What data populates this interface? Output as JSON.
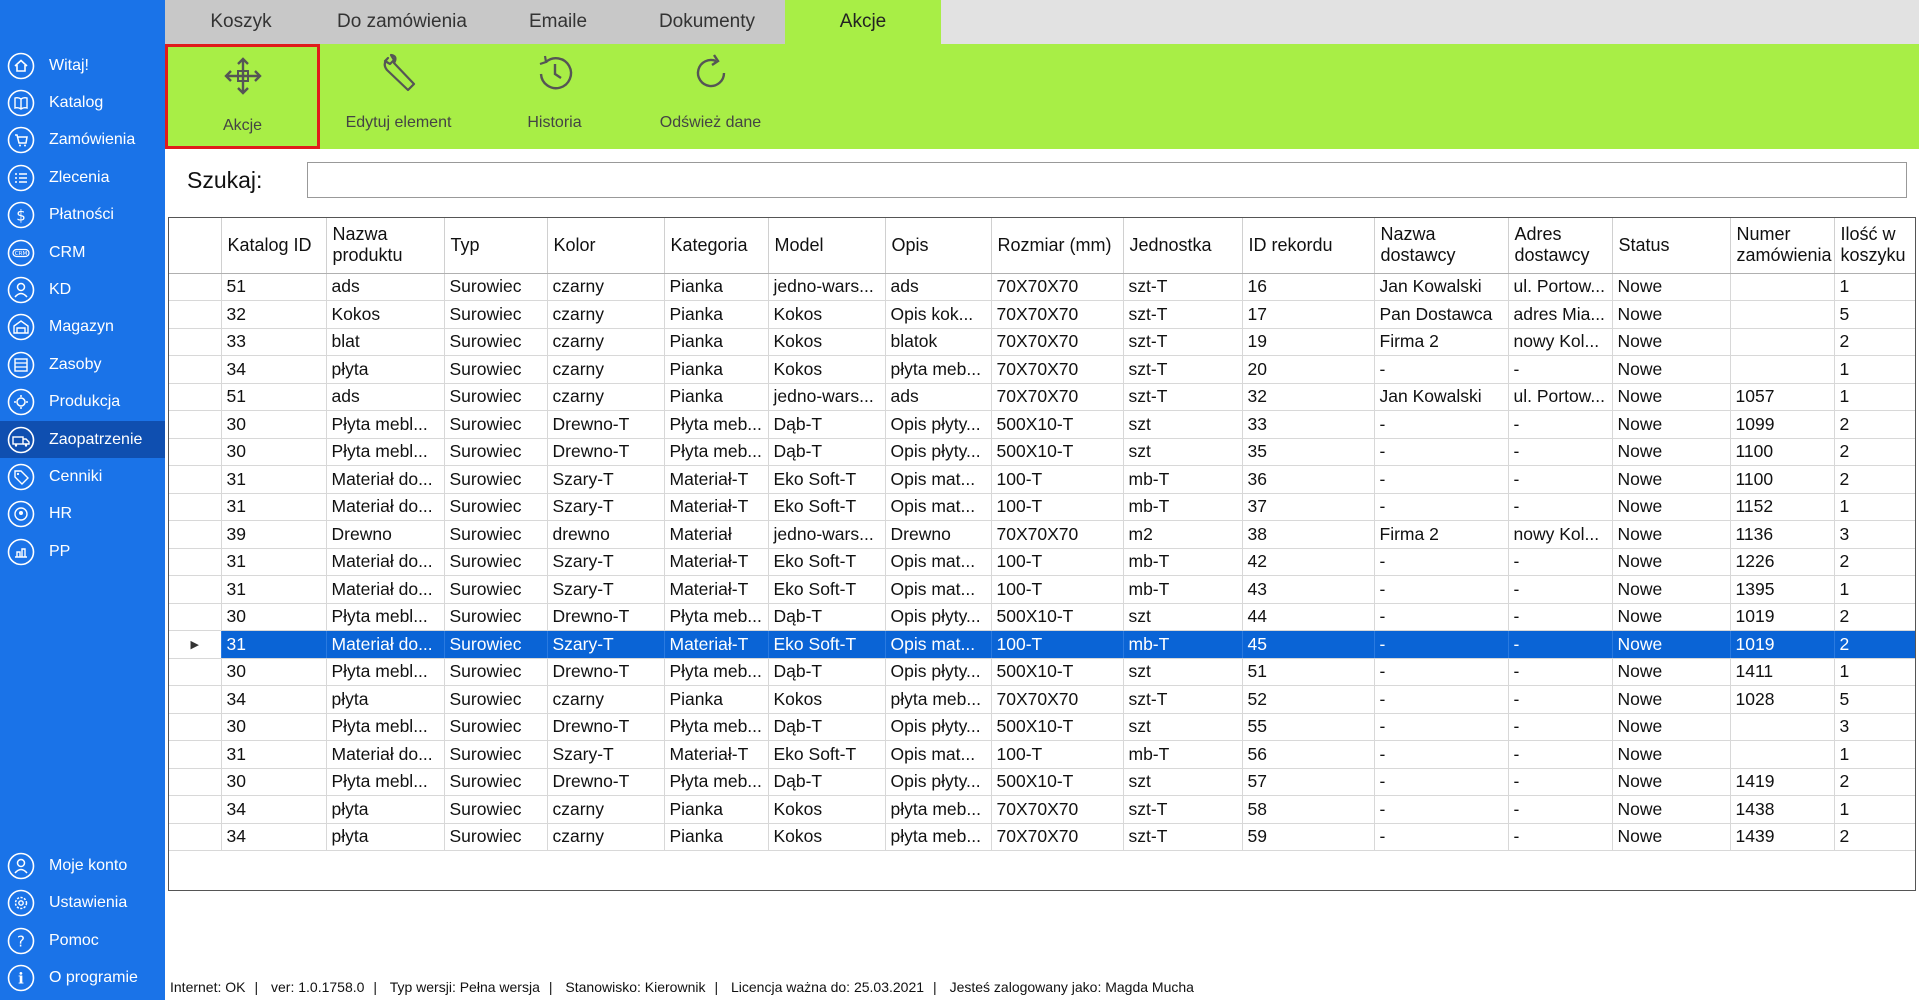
{
  "sidebar": {
    "items": [
      {
        "label": "Witaj!",
        "icon": "home-icon"
      },
      {
        "label": "Katalog",
        "icon": "book-icon"
      },
      {
        "label": "Zamówienia",
        "icon": "cart-icon"
      },
      {
        "label": "Zlecenia",
        "icon": "list-icon"
      },
      {
        "label": "Płatności",
        "icon": "dollar-icon"
      },
      {
        "label": "CRM",
        "icon": "crm-icon"
      },
      {
        "label": "KD",
        "icon": "user-icon"
      },
      {
        "label": "Magazyn",
        "icon": "warehouse-icon"
      },
      {
        "label": "Zasoby",
        "icon": "archive-icon"
      },
      {
        "label": "Produkcja",
        "icon": "production-icon"
      },
      {
        "label": "Zaopatrzenie",
        "icon": "supply-icon"
      },
      {
        "label": "Cenniki",
        "icon": "tag-icon"
      },
      {
        "label": "HR",
        "icon": "hr-icon"
      },
      {
        "label": "PP",
        "icon": "pp-icon"
      }
    ],
    "bottom_items": [
      {
        "label": "Moje konto",
        "icon": "account-icon"
      },
      {
        "label": "Ustawienia",
        "icon": "gear-icon"
      },
      {
        "label": "Pomoc",
        "icon": "help-icon"
      },
      {
        "label": "O programie",
        "icon": "info-icon"
      }
    ]
  },
  "tabs": [
    {
      "label": "Koszyk"
    },
    {
      "label": "Do zamówienia"
    },
    {
      "label": "Emaile"
    },
    {
      "label": "Dokumenty"
    },
    {
      "label": "Akcje"
    }
  ],
  "ribbon": {
    "buttons": [
      {
        "label": "Akcje",
        "icon": "move-arrows-icon"
      },
      {
        "label": "Edytuj element",
        "icon": "wrench-icon"
      },
      {
        "label": "Historia",
        "icon": "history-icon"
      },
      {
        "label": "Odśwież dane",
        "icon": "refresh-icon"
      }
    ]
  },
  "search": {
    "label": "Szukaj:",
    "value": ""
  },
  "table": {
    "columns": [
      "Katalog ID",
      "Nazwa produktu",
      "Typ",
      "Kolor",
      "Kategoria",
      "Model",
      "Opis",
      "Rozmiar (mm)",
      "Jednostka",
      "ID rekordu",
      "Nazwa dostawcy",
      "Adres dostawcy",
      "Status",
      "Numer zamówienia",
      "Ilość w koszyku"
    ],
    "rows": [
      [
        "51",
        "ads",
        "Surowiec",
        "czarny",
        "Pianka",
        "jedno-wars...",
        "ads",
        "70X70X70",
        "szt-T",
        "16",
        "Jan Kowalski",
        "ul. Portow...",
        "Nowe",
        "",
        "1"
      ],
      [
        "32",
        "Kokos",
        "Surowiec",
        "czarny",
        "Pianka",
        "Kokos",
        "Opis kok...",
        "70X70X70",
        "szt-T",
        "17",
        "Pan Dostawca",
        "adres Mia...",
        "Nowe",
        "",
        "5"
      ],
      [
        "33",
        "blat",
        "Surowiec",
        "czarny",
        "Pianka",
        "Kokos",
        "blatok",
        "70X70X70",
        "szt-T",
        "19",
        "Firma 2",
        "nowy Kol...",
        "Nowe",
        "",
        "2"
      ],
      [
        "34",
        "płyta",
        "Surowiec",
        "czarny",
        "Pianka",
        "Kokos",
        "płyta meb...",
        "70X70X70",
        "szt-T",
        "20",
        "-",
        "-",
        "Nowe",
        "",
        "1"
      ],
      [
        "51",
        "ads",
        "Surowiec",
        "czarny",
        "Pianka",
        "jedno-wars...",
        "ads",
        "70X70X70",
        "szt-T",
        "32",
        "Jan Kowalski",
        "ul. Portow...",
        "Nowe",
        "1057",
        "1"
      ],
      [
        "30",
        "Płyta mebl...",
        "Surowiec",
        "Drewno-T",
        "Płyta meb...",
        "Dąb-T",
        "Opis płyty...",
        "500X10-T",
        "szt",
        "33",
        "-",
        "-",
        "Nowe",
        "1099",
        "2"
      ],
      [
        "30",
        "Płyta mebl...",
        "Surowiec",
        "Drewno-T",
        "Płyta meb...",
        "Dąb-T",
        "Opis płyty...",
        "500X10-T",
        "szt",
        "35",
        "-",
        "-",
        "Nowe",
        "1100",
        "2"
      ],
      [
        "31",
        "Materiał do...",
        "Surowiec",
        "Szary-T",
        "Materiał-T",
        "Eko Soft-T",
        "Opis mat...",
        "100-T",
        "mb-T",
        "36",
        "-",
        "-",
        "Nowe",
        "1100",
        "2"
      ],
      [
        "31",
        "Materiał do...",
        "Surowiec",
        "Szary-T",
        "Materiał-T",
        "Eko Soft-T",
        "Opis mat...",
        "100-T",
        "mb-T",
        "37",
        "-",
        "-",
        "Nowe",
        "1152",
        "1"
      ],
      [
        "39",
        "Drewno",
        "Surowiec",
        "drewno",
        "Materiał",
        "jedno-wars...",
        "Drewno",
        "70X70X70",
        "m2",
        "38",
        "Firma 2",
        "nowy Kol...",
        "Nowe",
        "1136",
        "3"
      ],
      [
        "31",
        "Materiał do...",
        "Surowiec",
        "Szary-T",
        "Materiał-T",
        "Eko Soft-T",
        "Opis mat...",
        "100-T",
        "mb-T",
        "42",
        "-",
        "-",
        "Nowe",
        "1226",
        "2"
      ],
      [
        "31",
        "Materiał do...",
        "Surowiec",
        "Szary-T",
        "Materiał-T",
        "Eko Soft-T",
        "Opis mat...",
        "100-T",
        "mb-T",
        "43",
        "-",
        "-",
        "Nowe",
        "1395",
        "1"
      ],
      [
        "30",
        "Płyta mebl...",
        "Surowiec",
        "Drewno-T",
        "Płyta meb...",
        "Dąb-T",
        "Opis płyty...",
        "500X10-T",
        "szt",
        "44",
        "-",
        "-",
        "Nowe",
        "1019",
        "2"
      ],
      [
        "31",
        "Materiał do...",
        "Surowiec",
        "Szary-T",
        "Materiał-T",
        "Eko Soft-T",
        "Opis mat...",
        "100-T",
        "mb-T",
        "45",
        "-",
        "-",
        "Nowe",
        "1019",
        "2"
      ],
      [
        "30",
        "Płyta mebl...",
        "Surowiec",
        "Drewno-T",
        "Płyta meb...",
        "Dąb-T",
        "Opis płyty...",
        "500X10-T",
        "szt",
        "51",
        "-",
        "-",
        "Nowe",
        "1411",
        "1"
      ],
      [
        "34",
        "płyta",
        "Surowiec",
        "czarny",
        "Pianka",
        "Kokos",
        "płyta meb...",
        "70X70X70",
        "szt-T",
        "52",
        "-",
        "-",
        "Nowe",
        "1028",
        "5"
      ],
      [
        "30",
        "Płyta mebl...",
        "Surowiec",
        "Drewno-T",
        "Płyta meb...",
        "Dąb-T",
        "Opis płyty...",
        "500X10-T",
        "szt",
        "55",
        "-",
        "-",
        "Nowe",
        "",
        "3"
      ],
      [
        "31",
        "Materiał do...",
        "Surowiec",
        "Szary-T",
        "Materiał-T",
        "Eko Soft-T",
        "Opis mat...",
        "100-T",
        "mb-T",
        "56",
        "-",
        "-",
        "Nowe",
        "",
        "1"
      ],
      [
        "30",
        "Płyta mebl...",
        "Surowiec",
        "Drewno-T",
        "Płyta meb...",
        "Dąb-T",
        "Opis płyty...",
        "500X10-T",
        "szt",
        "57",
        "-",
        "-",
        "Nowe",
        "1419",
        "2"
      ],
      [
        "34",
        "płyta",
        "Surowiec",
        "czarny",
        "Pianka",
        "Kokos",
        "płyta meb...",
        "70X70X70",
        "szt-T",
        "58",
        "-",
        "-",
        "Nowe",
        "1438",
        "1"
      ],
      [
        "34",
        "płyta",
        "Surowiec",
        "czarny",
        "Pianka",
        "Kokos",
        "płyta meb...",
        "70X70X70",
        "szt-T",
        "59",
        "-",
        "-",
        "Nowe",
        "1439",
        "2"
      ]
    ]
  },
  "status": {
    "parts": [
      "Internet: OK",
      "ver: 1.0.1758.0",
      "Typ wersji: Pełna wersja",
      "Stanowisko: Kierownik",
      "Licencja ważna do: 25.03.2021",
      "Jesteś zalogowany jako: Magda Mucha"
    ]
  },
  "colors": {
    "sidebar_bg": "#1a73e8",
    "sidebar_active": "#0f4fb0",
    "ribbon_bg": "#a8ee46",
    "selected_row": "#0a64d6",
    "ribbon_selected_border": "#e01b1b"
  }
}
